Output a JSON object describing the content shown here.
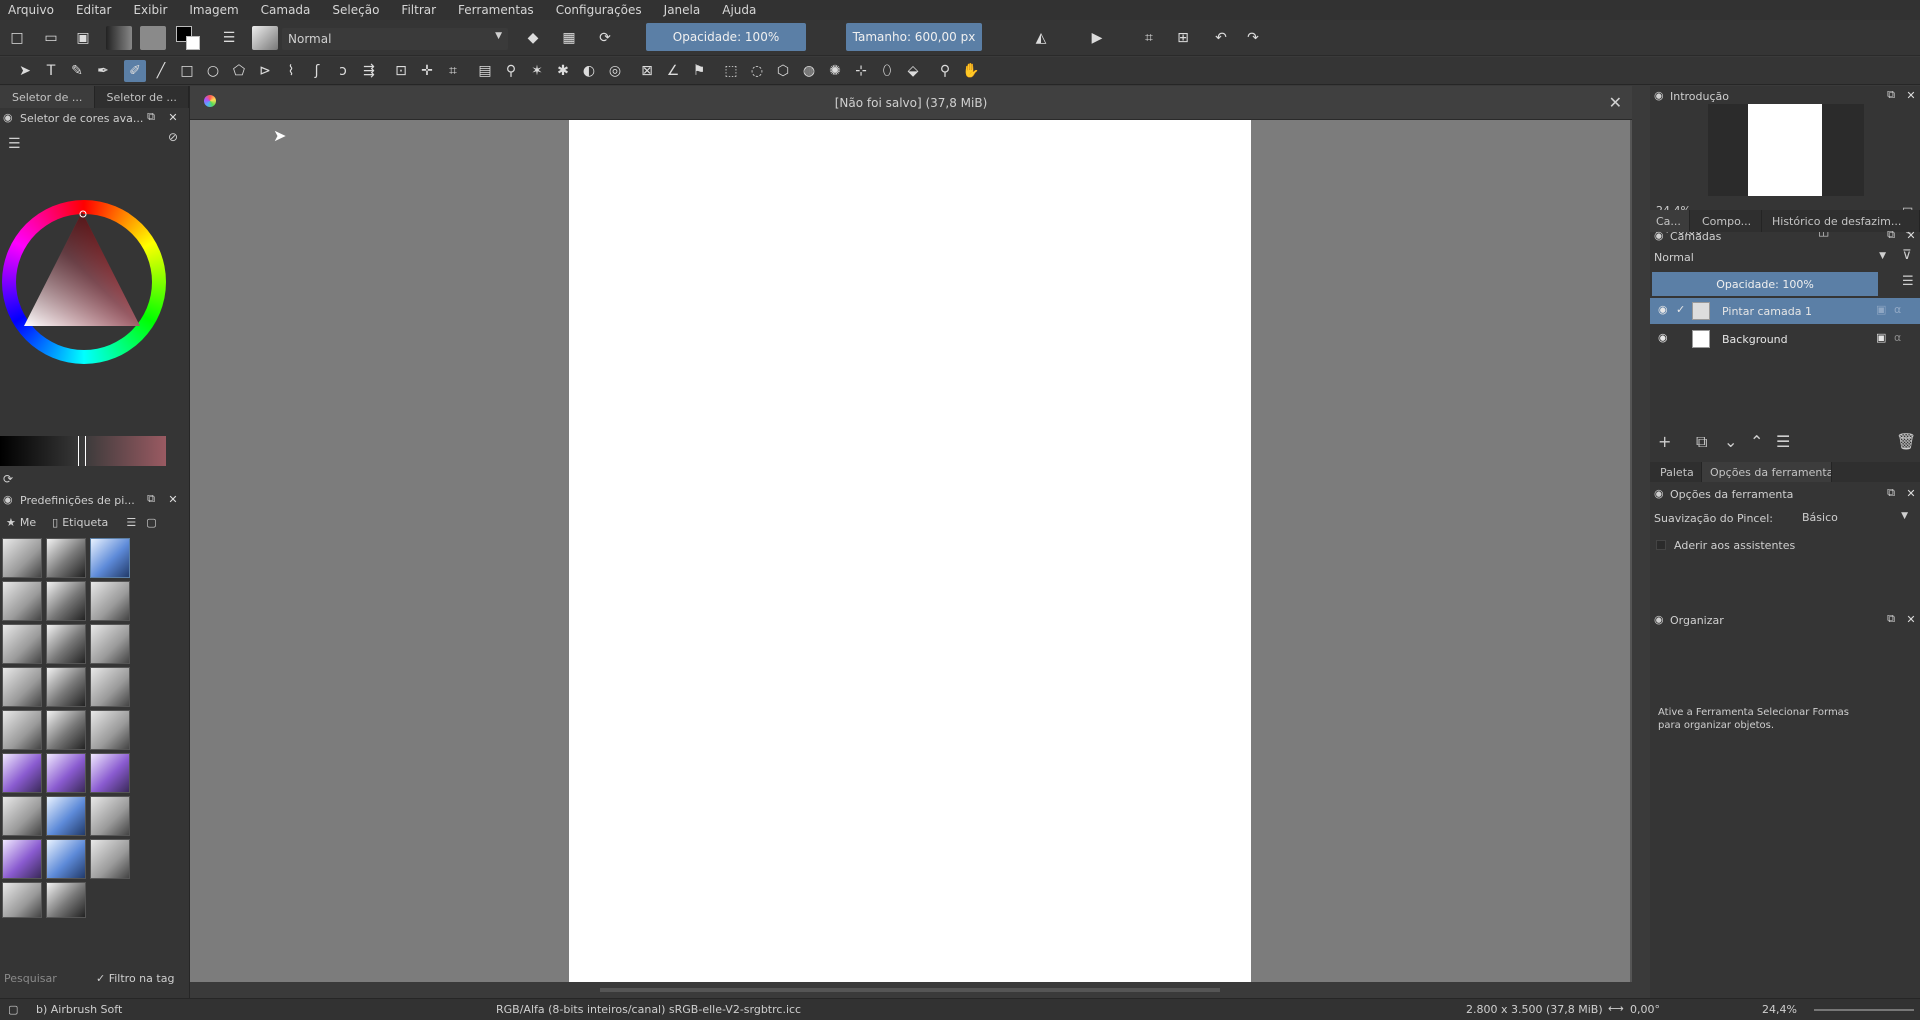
{
  "menu": [
    "Arquivo",
    "Editar",
    "Exibir",
    "Imagem",
    "Camada",
    "Seleção",
    "Filtrar",
    "Ferramentas",
    "Configurações",
    "Janela",
    "Ajuda"
  ],
  "toolbar": {
    "blend_mode": "Normal",
    "opacity": "Opacidade: 100%",
    "size": "Tamanho: 600,00 px"
  },
  "left_dock": {
    "tabs": [
      "Seletor de ...",
      "Seletor de ..."
    ],
    "color_panel_title": "Seletor de cores ava...",
    "brush_panel_title": "Predefinições de pi...",
    "brush_filter_label": "Me",
    "brush_tag_label": "Etiqueta",
    "search_placeholder": "Pesquisar",
    "filter_tag_label": "Filtro na tag"
  },
  "document": {
    "tab_title": "[Não foi salvo] (37,8 MiB)"
  },
  "right_dock": {
    "overview_title": "Introdução",
    "zoom_value": "24,4%",
    "rotation_value": "0,00°",
    "tabs": [
      "Ca...",
      "Compo...",
      "Histórico de desfazim..."
    ],
    "layers_title": "Camadas",
    "layers_blend": "Normal",
    "layers_opacity": "Opacidade:  100%",
    "layers": [
      {
        "name": "Pintar camada 1"
      },
      {
        "name": "Background"
      }
    ],
    "bottom_tabs": [
      "Paleta",
      "Opções da ferramenta"
    ],
    "tool_options_title": "Opções da ferramenta",
    "smoothing_label": "Suavização do Pincel:",
    "smoothing_value": "Básico",
    "snap_label": "Aderir aos assistentes",
    "organizer_title": "Organizar",
    "organizer_hint": "Ative a Ferramenta Selecionar Formas para organizar objetos."
  },
  "status": {
    "brush_name": "b) Airbrush Soft",
    "color_space": "RGB/Alfa (8-bits inteiros/canal)  sRGB-elle-V2-srgbtrc.icc",
    "dimensions": "2.800 x 3.500 (37,8 MiB)",
    "rotation": "0,00°",
    "zoom": "24,4%"
  },
  "colors": {
    "accent": "#5b7fa6",
    "canvas_bg": "#7c7c7c",
    "panel_bg": "#353535"
  }
}
